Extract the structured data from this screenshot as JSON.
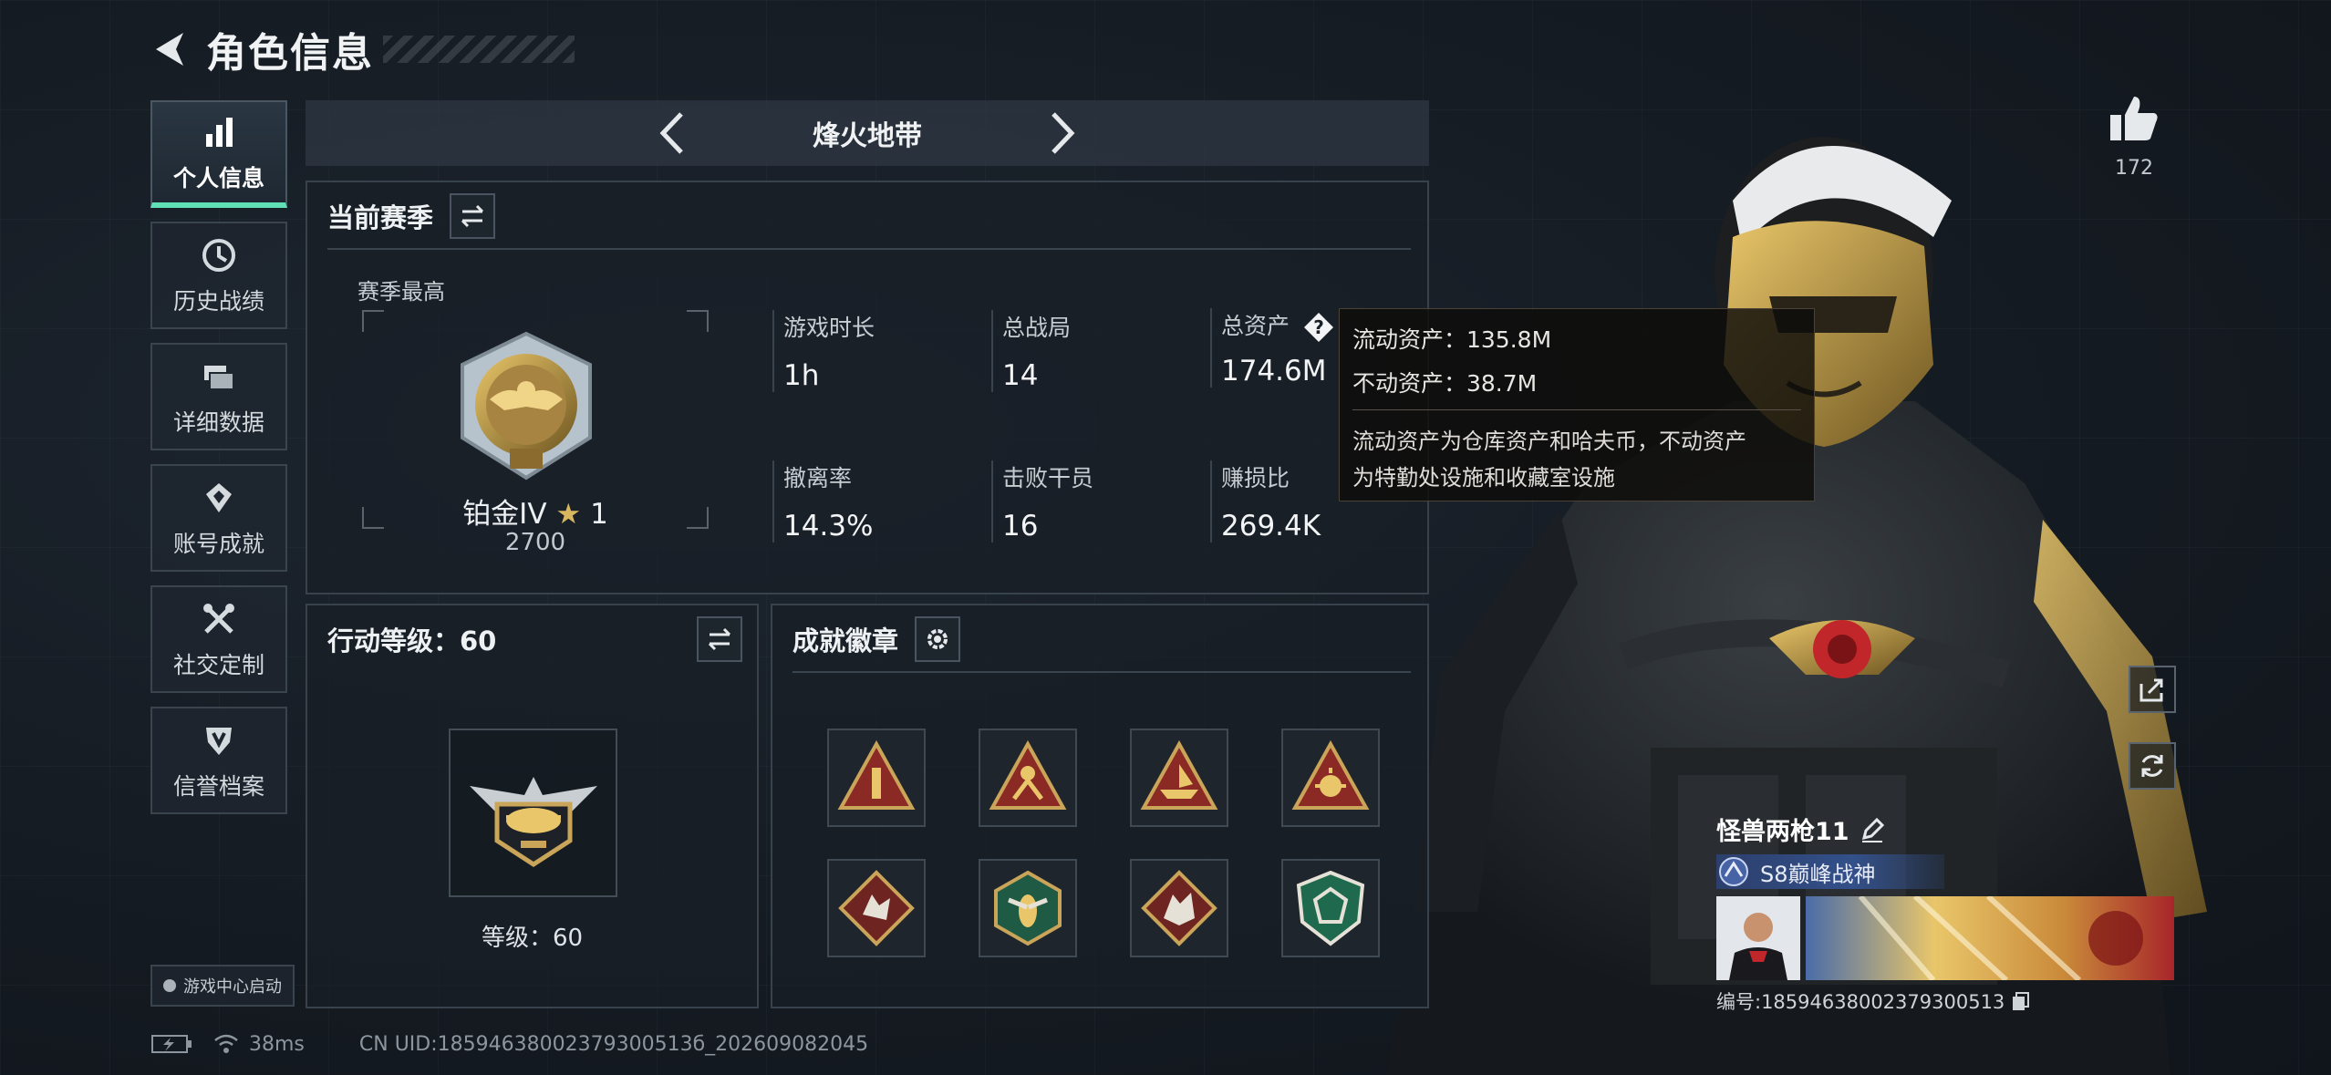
{
  "header": {
    "title": "角色信息"
  },
  "sidenav": {
    "items": [
      {
        "label": "个人信息",
        "icon": "bar-chart-icon",
        "active": true
      },
      {
        "label": "历史战绩",
        "icon": "history-icon",
        "active": false
      },
      {
        "label": "详细数据",
        "icon": "data-layers-icon",
        "active": false
      },
      {
        "label": "账号成就",
        "icon": "achievement-icon",
        "active": false
      },
      {
        "label": "社交定制",
        "icon": "tools-icon",
        "active": false
      },
      {
        "label": "信誉档案",
        "icon": "reputation-icon",
        "active": false
      }
    ],
    "launch_label": "游戏中心启动"
  },
  "mode": {
    "name": "烽火地带"
  },
  "season": {
    "title": "当前赛季",
    "sub_label": "赛季最高",
    "rank_name": "铂金IV",
    "rank_stars": "1",
    "rank_score": "2700",
    "stats": [
      {
        "label": "游戏时长",
        "value": "1h"
      },
      {
        "label": "总战局",
        "value": "14"
      },
      {
        "label": "总资产",
        "value": "174.6M",
        "has_help": true
      },
      {
        "label": "撤离率",
        "value": "14.3%"
      },
      {
        "label": "击败干员",
        "value": "16"
      },
      {
        "label": "赚损比",
        "value": "269.4K"
      }
    ]
  },
  "tooltip": {
    "liquid": "流动资产：135.8M",
    "fixed": "不动资产：38.7M",
    "desc_line1": "流动资产为仓库资产和哈夫币，不动资产",
    "desc_line2": "为特勤处设施和收藏室设施"
  },
  "level": {
    "title": "行动等级：60",
    "level_text": "等级：60"
  },
  "achievements": {
    "title": "成就徽章",
    "badges": [
      "tower-badge-icon",
      "climber-badge-icon",
      "boat-badge-icon",
      "sun-badge-icon",
      "wolf-badge-icon",
      "wasp-badge-icon",
      "dragon-badge-icon",
      "shield-badge-icon"
    ]
  },
  "likes": {
    "count": "172"
  },
  "player": {
    "name": "怪兽两枪11",
    "title": "S8巅峰战神",
    "id_text": "编号:18594638002379300513"
  },
  "footer": {
    "ping": "38ms",
    "uid": "CN UID:18594638002379300513б_202609082045"
  },
  "colors": {
    "accent": "#5fe0b5",
    "gold": "#c9a459",
    "badge_red": "#8b2a24",
    "badge_green": "#1f6a4f"
  }
}
